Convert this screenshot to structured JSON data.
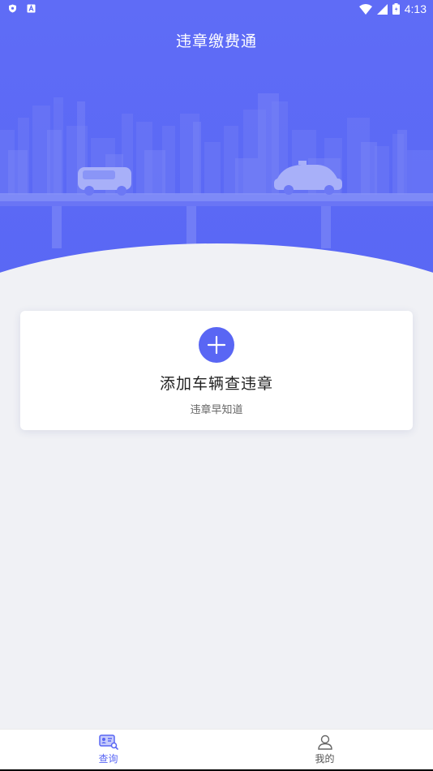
{
  "status_bar": {
    "time": "4:13",
    "left_icons": [
      "shield-icon",
      "a-icon"
    ],
    "right_icons": [
      "wifi-icon",
      "signal-icon",
      "battery-icon"
    ]
  },
  "header": {
    "title": "违章缴费通"
  },
  "add_card": {
    "icon": "plus-icon",
    "title": "添加车辆查违章",
    "subtitle": "违章早知道"
  },
  "tabbar": {
    "tabs": [
      {
        "label": "查询",
        "icon": "id-card-search-icon",
        "active": true
      },
      {
        "label": "我的",
        "icon": "user-icon",
        "active": false
      }
    ]
  },
  "colors": {
    "accent": "#5966f4",
    "hero": "#5f6cf6",
    "background": "#f0f1f5"
  }
}
